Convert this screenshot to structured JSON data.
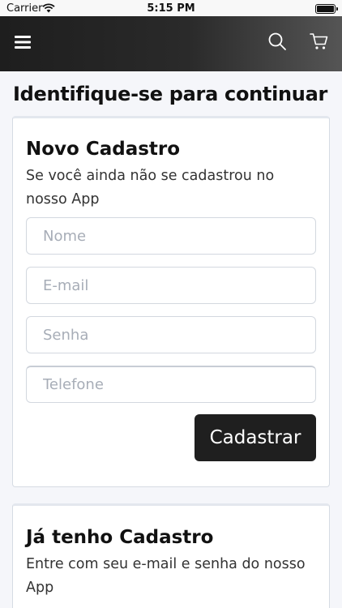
{
  "status_bar": {
    "carrier": "Carrier",
    "time": "5:15 PM"
  },
  "navbar": {
    "icons": {
      "menu": "hamburger-icon",
      "search": "search-icon",
      "cart": "cart-icon"
    }
  },
  "page": {
    "title": "Identifique-se para continuar"
  },
  "new_account": {
    "title": "Novo Cadastro",
    "description": "Se você ainda não se cadastrou no nosso App",
    "fields": {
      "name_placeholder": "Nome",
      "email_placeholder": "E-mail",
      "password_placeholder": "Senha",
      "phone_placeholder": "Telefone"
    },
    "submit_label": "Cadastrar"
  },
  "login": {
    "title": "Já tenho Cadastro",
    "description": "Entre com seu e-mail e senha do nosso App"
  }
}
